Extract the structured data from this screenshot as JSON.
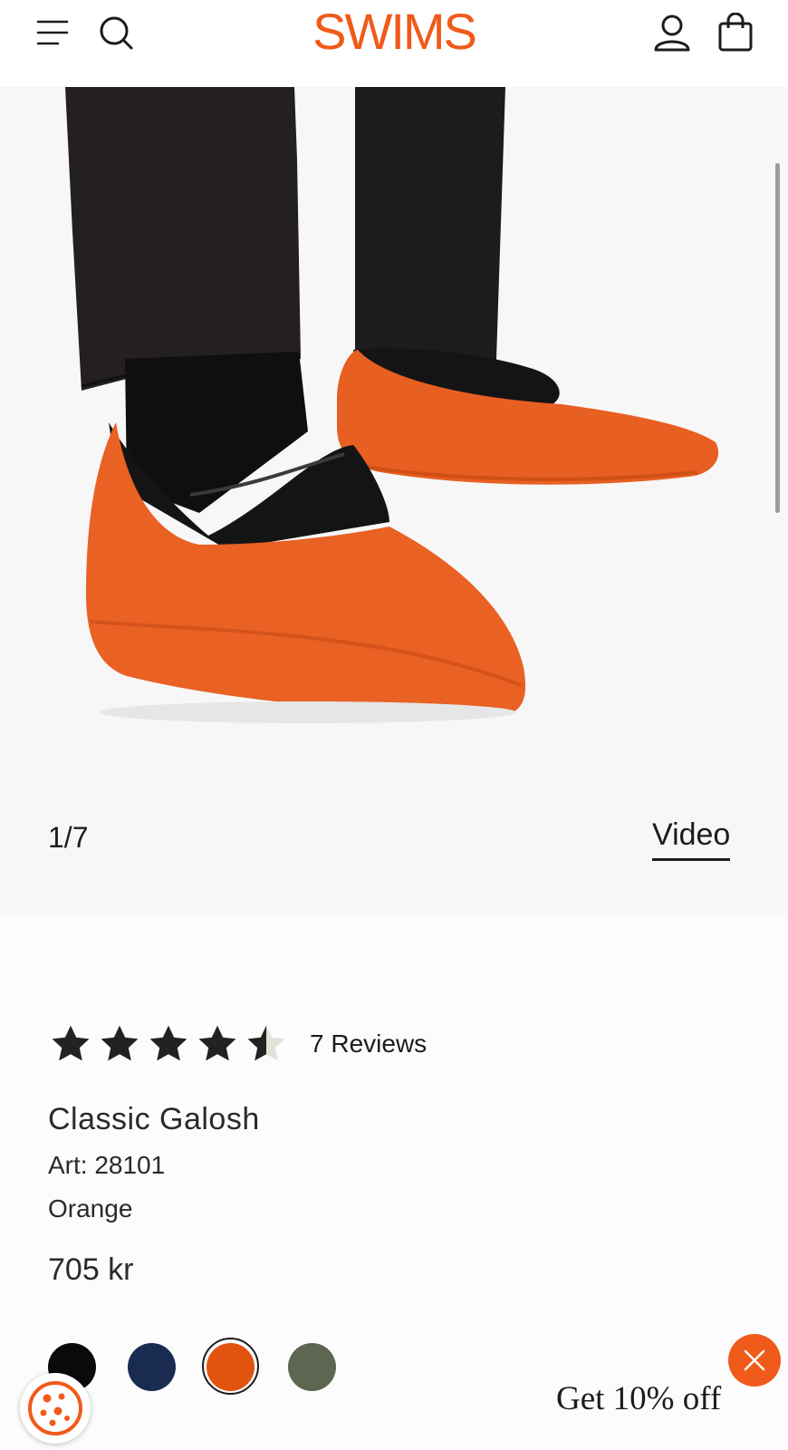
{
  "header": {
    "logo_text": "SWIMS",
    "icons": [
      "menu-icon",
      "search-icon",
      "account-icon",
      "cart-icon"
    ]
  },
  "gallery": {
    "counter": "1/7",
    "video_label": "Video"
  },
  "product": {
    "rating": 4.5,
    "reviews_label": "7 Reviews",
    "title": "Classic Galosh",
    "art": "Art: 28101",
    "color": "Orange",
    "price": "705 kr",
    "swatches": [
      "#0a0a0a",
      "#1a2b52",
      "#e2530f",
      "#5e6652"
    ],
    "selected_swatch": 2
  },
  "promo": {
    "label": "Get 10% off"
  },
  "colors": {
    "brand": "#f05a1a"
  }
}
